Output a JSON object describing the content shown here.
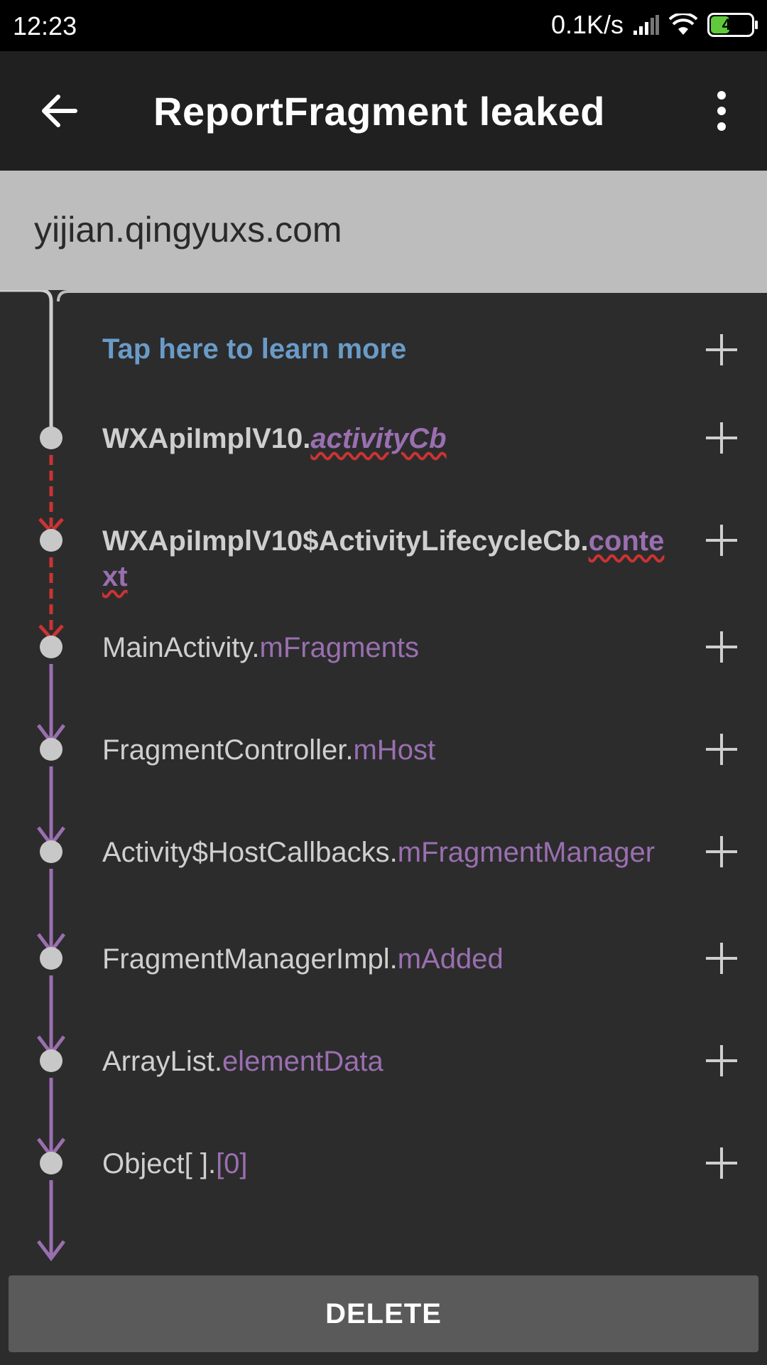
{
  "status": {
    "time": "12:23",
    "network_speed": "0.1K/s",
    "battery": "46"
  },
  "appbar": {
    "title": "ReportFragment leaked"
  },
  "subheader": {
    "package": "yijian.qingyuxs.com"
  },
  "trace": {
    "learn_more": "Tap here to learn more",
    "rows": [
      {
        "class": "WXApiImplV10.",
        "field": "activityCb"
      },
      {
        "class": "WXApiImplV10$ActivityLifecycleCb.",
        "field": "context"
      },
      {
        "class": "MainActivity.",
        "field": "mFragments"
      },
      {
        "class": "FragmentController.",
        "field": "mHost"
      },
      {
        "class": "Activity$HostCallbacks.",
        "field": "mFragmentManager"
      },
      {
        "class": "FragmentManagerImpl.",
        "field": "mAdded"
      },
      {
        "class": "ArrayList.",
        "field": "elementData"
      },
      {
        "class": "Object[ ].",
        "field": "[0]"
      }
    ]
  },
  "actions": {
    "delete_label": "DELETE"
  },
  "colors": {
    "leak_suspect": "#cc3333",
    "reference": "#9a6fb0",
    "link": "#6a9bc7"
  }
}
